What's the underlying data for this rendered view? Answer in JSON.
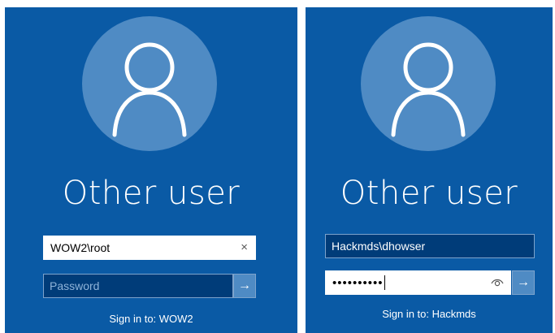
{
  "left_panel": {
    "title": "Other user",
    "username_value": "WOW2\\root",
    "clear_glyph": "×",
    "password_placeholder": "Password",
    "submit_glyph": "→",
    "sign_in_to": "Sign in to: WOW2"
  },
  "right_panel": {
    "title": "Other user",
    "username_value": "Hackmds\\dhowser",
    "password_masked": "••••••••••",
    "submit_glyph": "→",
    "sign_in_to": "Sign in to: Hackmds"
  },
  "colors": {
    "background": "#0a5aa5",
    "avatar_circle": "#4f8bc4",
    "dark_field": "#003c79"
  },
  "icons": [
    "user-avatar-icon",
    "clear-icon",
    "arrow-right-icon",
    "reveal-password-eye-icon"
  ]
}
